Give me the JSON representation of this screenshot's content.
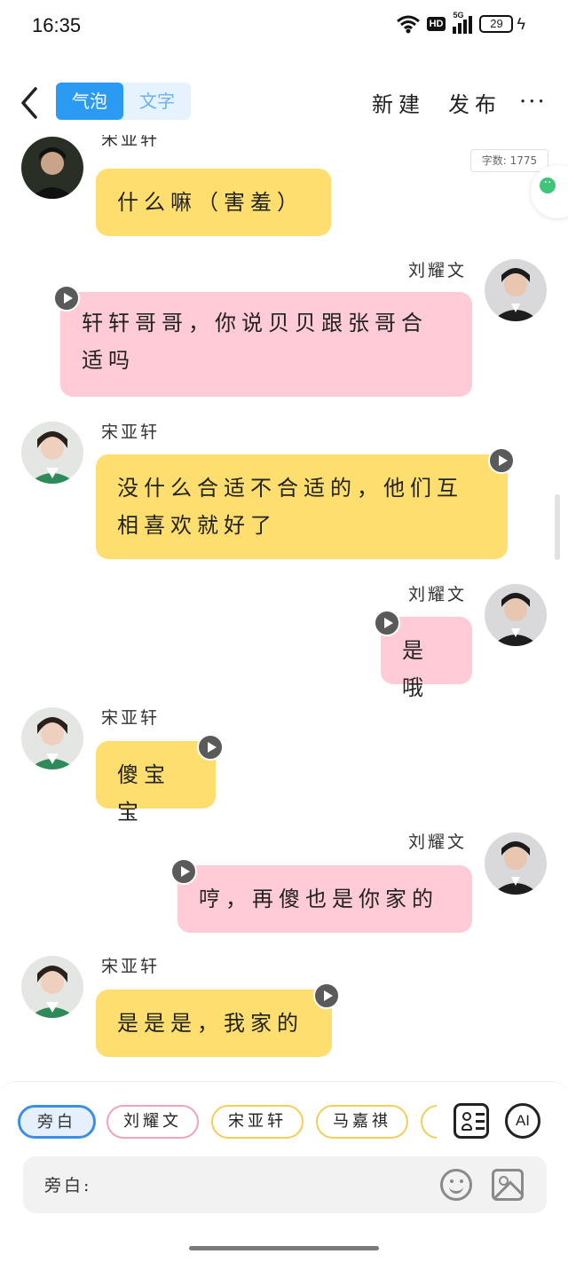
{
  "status_bar": {
    "time": "16:35",
    "network": "5G",
    "hd": "HD",
    "battery": "29"
  },
  "header": {
    "modes": [
      {
        "label": "气泡"
      },
      {
        "label": "文字"
      }
    ],
    "new_label": "新建",
    "publish_label": "发布",
    "more": "···"
  },
  "word_count": "字数: 1775",
  "messages": [
    {
      "side": "left",
      "name": "宋亚轩",
      "lines": [
        "什么嘛（害羞）"
      ],
      "color": "yellow"
    },
    {
      "side": "right",
      "name": "刘耀文",
      "lines": [
        "轩轩哥哥，你说贝贝跟张哥合",
        "适吗"
      ],
      "color": "pink"
    },
    {
      "side": "left",
      "name": "宋亚轩",
      "lines": [
        "没什么合适不合适的，他们互",
        "相喜欢就好了"
      ],
      "color": "yellow"
    },
    {
      "side": "right",
      "name": "刘耀文",
      "lines": [
        "是哦"
      ],
      "color": "pink"
    },
    {
      "side": "left",
      "name": "宋亚轩",
      "lines": [
        "傻宝宝"
      ],
      "color": "yellow"
    },
    {
      "side": "right",
      "name": "刘耀文",
      "lines": [
        "哼，再傻也是你家的"
      ],
      "color": "pink"
    },
    {
      "side": "left",
      "name": "宋亚轩",
      "lines": [
        "是是是，我家的"
      ],
      "color": "yellow"
    }
  ],
  "roles": [
    {
      "label": "旁白"
    },
    {
      "label": "刘耀文"
    },
    {
      "label": "宋亚轩"
    },
    {
      "label": "马嘉祺"
    }
  ],
  "ai_label": "AI",
  "input": {
    "label": "旁白:"
  },
  "colors": {
    "accent": "#2b9af3",
    "yellow_bubble": "#fede6e",
    "pink_bubble": "#fecbd7"
  },
  "icons": [
    "back-arrow-icon",
    "wifi-icon",
    "signal-icon",
    "battery-icon",
    "play-icon",
    "role-card-icon",
    "emoji-icon",
    "image-icon"
  ]
}
